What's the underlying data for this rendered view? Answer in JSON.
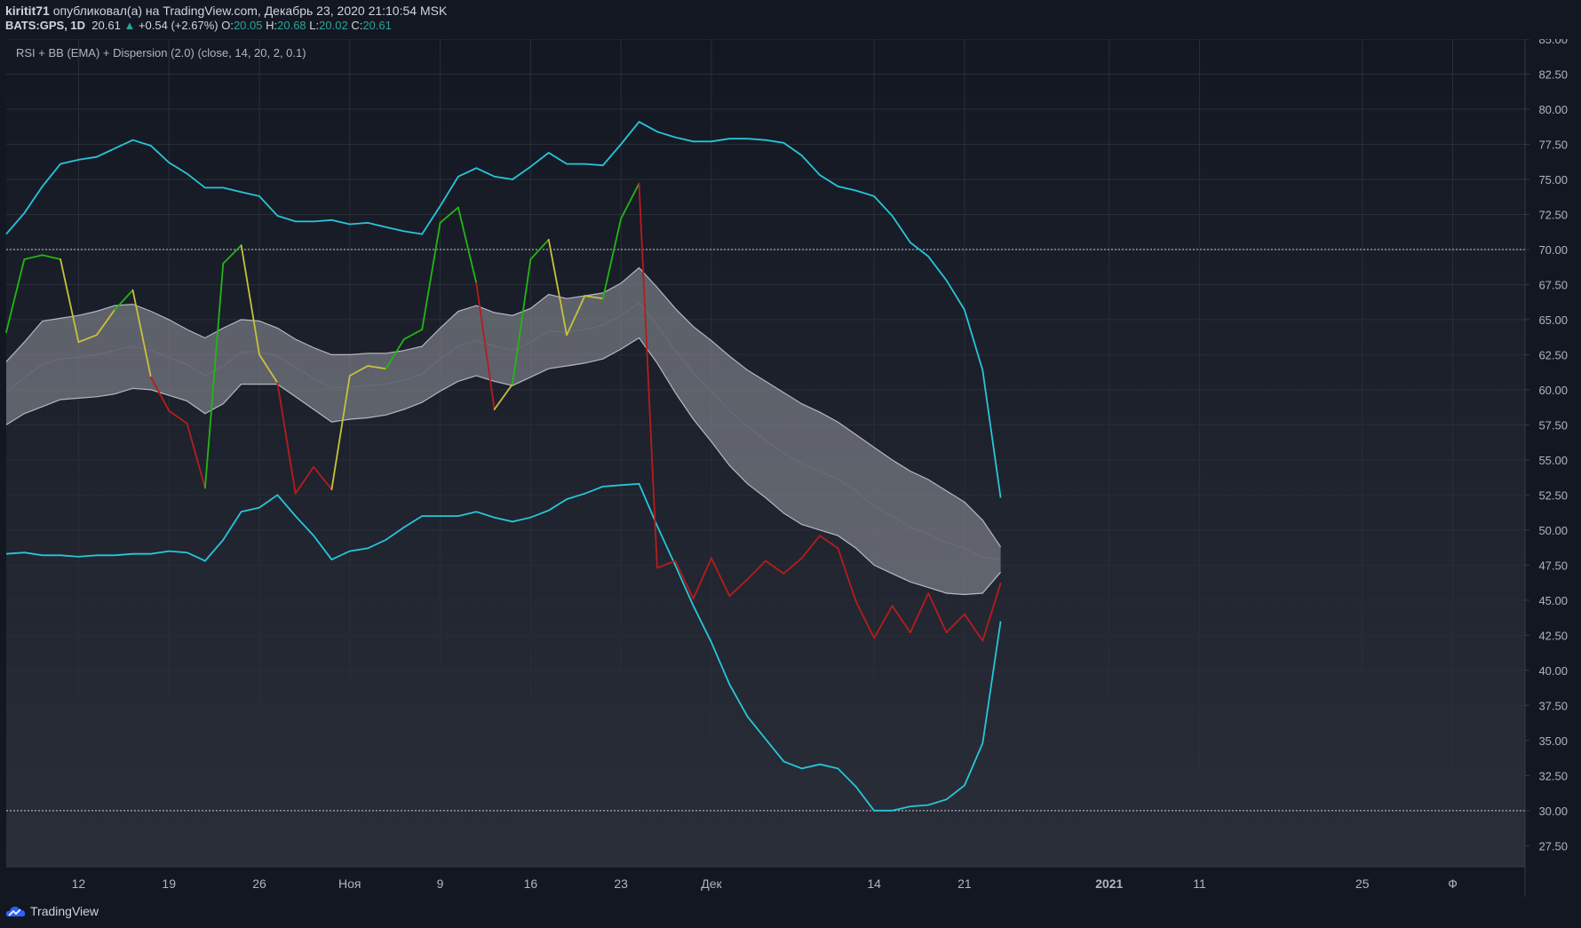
{
  "header": {
    "author": "kiritit71",
    "published": "опубликовал(а) на TradingView.com, Декабрь 23, 2020 21:10:54 MSK",
    "symbol": "BATS:GPS, 1D",
    "last": "20.61",
    "change": "+0.54 (+2.67%)",
    "o_label": "O:",
    "o": "20.05",
    "h_label": "H:",
    "h": "20.68",
    "l_label": "L:",
    "l": "20.02",
    "c_label": "C:",
    "c": "20.61"
  },
  "footer": {
    "brand": "TradingView"
  },
  "colors": {
    "bg_top": "#131722",
    "bg_bottom": "#2a2e39",
    "rsi_bull": "#22b614",
    "rsi_neutral": "#c8c13b",
    "rsi_bear": "#b71c1c",
    "outer_band": "#26c6da",
    "inner_band_fill": "#8a8d96",
    "up": "#26a69a"
  },
  "chart_data": {
    "type": "line",
    "title": "RSI + BB (EMA) + Dispersion (2.0) (close, 14, 20, 2, 0.1)",
    "ylim": [
      26,
      85
    ],
    "yticks": [
      27.5,
      30,
      32.5,
      35,
      37.5,
      40,
      42.5,
      45,
      47.5,
      50,
      52.5,
      55,
      57.5,
      60,
      62.5,
      65,
      67.5,
      70,
      72.5,
      75,
      77.5,
      80,
      82.5,
      85
    ],
    "hlines": [
      70,
      30
    ],
    "xlim": [
      0,
      84
    ],
    "xticks": [
      {
        "i": 4,
        "label": "12"
      },
      {
        "i": 9,
        "label": "19"
      },
      {
        "i": 14,
        "label": "26"
      },
      {
        "i": 19,
        "label": "Ноя"
      },
      {
        "i": 24,
        "label": "9"
      },
      {
        "i": 29,
        "label": "16"
      },
      {
        "i": 34,
        "label": "23"
      },
      {
        "i": 39,
        "label": "Дек"
      },
      {
        "i": 48,
        "label": "14"
      },
      {
        "i": 53,
        "label": "21"
      },
      {
        "i": 61,
        "label": "2021"
      },
      {
        "i": 66,
        "label": "11"
      },
      {
        "i": 75,
        "label": "25"
      },
      {
        "i": 80,
        "label": "Ф"
      }
    ],
    "series": [
      {
        "key": "rsi",
        "values": [
          64.1,
          69.3,
          69.6,
          69.3,
          63.4,
          63.9,
          65.7,
          67.1,
          60.9,
          58.5,
          57.6,
          53.0,
          69.0,
          70.3,
          62.5,
          60.5,
          52.6,
          54.5,
          52.9,
          61.0,
          61.7,
          61.5,
          63.6,
          64.3,
          71.9,
          73.0,
          67.6,
          58.6,
          60.4,
          69.3,
          70.7,
          63.9,
          66.7,
          66.5,
          72.2,
          74.7,
          47.3,
          47.8,
          45.1,
          48.0,
          45.3,
          46.5,
          47.8,
          46.9,
          48.0,
          49.6,
          48.7,
          44.9,
          42.3,
          44.6,
          42.7,
          45.5,
          42.7,
          44.0,
          42.1,
          46.2
        ]
      },
      {
        "key": "outer_upper",
        "values": [
          71.1,
          72.6,
          74.5,
          76.1,
          76.4,
          76.6,
          77.2,
          77.8,
          77.4,
          76.2,
          75.4,
          74.4,
          74.4,
          74.1,
          73.8,
          72.4,
          72.0,
          72.0,
          72.1,
          71.8,
          71.9,
          71.6,
          71.3,
          71.1,
          73.1,
          75.2,
          75.8,
          75.2,
          75.0,
          75.9,
          76.9,
          76.1,
          76.1,
          76.0,
          77.5,
          79.1,
          78.4,
          78.0,
          77.7,
          77.7,
          77.9,
          77.9,
          77.8,
          77.6,
          76.7,
          75.3,
          74.5,
          74.2,
          73.8,
          72.4,
          70.5,
          69.5,
          67.8,
          65.7,
          61.4,
          52.3
        ]
      },
      {
        "key": "outer_lower",
        "values": [
          48.3,
          48.4,
          48.2,
          48.2,
          48.1,
          48.2,
          48.2,
          48.3,
          48.3,
          48.5,
          48.4,
          47.8,
          49.3,
          51.3,
          51.6,
          52.5,
          51.0,
          49.6,
          47.9,
          48.5,
          48.7,
          49.3,
          50.2,
          51.0,
          51.0,
          51.0,
          51.3,
          50.9,
          50.6,
          50.9,
          51.4,
          52.2,
          52.6,
          53.1,
          53.2,
          53.3,
          50.3,
          47.5,
          44.6,
          42.0,
          39.0,
          36.7,
          35.1,
          33.5,
          33.0,
          33.3,
          33.0,
          31.7,
          30.0,
          30.0,
          30.3,
          30.4,
          30.8,
          31.8,
          34.8,
          43.5
        ]
      },
      {
        "key": "inner_upper",
        "values": [
          62.0,
          63.4,
          64.9,
          65.1,
          65.3,
          65.6,
          66.0,
          66.1,
          65.6,
          65.0,
          64.3,
          63.7,
          64.4,
          65.0,
          64.9,
          64.4,
          63.6,
          63.0,
          62.5,
          62.5,
          62.6,
          62.6,
          62.8,
          63.1,
          64.4,
          65.6,
          66.0,
          65.5,
          65.3,
          65.8,
          66.8,
          66.5,
          66.7,
          66.9,
          67.6,
          68.7,
          67.3,
          65.8,
          64.5,
          63.5,
          62.4,
          61.4,
          60.6,
          59.8,
          59.0,
          58.4,
          57.7,
          56.8,
          55.9,
          55.0,
          54.2,
          53.6,
          52.8,
          52.0,
          50.7,
          48.8
        ]
      },
      {
        "key": "inner_lower",
        "values": [
          57.5,
          58.3,
          58.8,
          59.3,
          59.4,
          59.5,
          59.7,
          60.1,
          60.0,
          59.6,
          59.2,
          58.3,
          59.0,
          60.4,
          60.4,
          60.4,
          59.5,
          58.6,
          57.7,
          57.9,
          58.0,
          58.2,
          58.6,
          59.1,
          59.9,
          60.6,
          61.0,
          60.6,
          60.3,
          60.9,
          61.5,
          61.7,
          61.9,
          62.2,
          62.9,
          63.7,
          61.9,
          59.8,
          57.9,
          56.3,
          54.6,
          53.3,
          52.3,
          51.2,
          50.4,
          50.0,
          49.6,
          48.7,
          47.5,
          46.9,
          46.3,
          45.9,
          45.5,
          45.4,
          45.5,
          47.0
        ]
      },
      {
        "key": "basis",
        "values": [
          59.8,
          60.9,
          61.8,
          62.2,
          62.3,
          62.5,
          62.8,
          63.1,
          62.8,
          62.3,
          61.8,
          61.0,
          61.7,
          62.7,
          62.7,
          62.4,
          61.6,
          60.8,
          60.1,
          60.2,
          60.3,
          60.4,
          60.7,
          61.1,
          62.2,
          63.1,
          63.5,
          63.1,
          62.8,
          63.4,
          64.2,
          64.1,
          64.3,
          64.6,
          65.3,
          66.2,
          64.6,
          62.8,
          61.2,
          59.9,
          58.5,
          57.4,
          56.4,
          55.5,
          54.7,
          54.2,
          53.6,
          52.8,
          51.7,
          51.0,
          50.2,
          49.7,
          49.1,
          48.7,
          48.1,
          47.9
        ]
      }
    ]
  }
}
